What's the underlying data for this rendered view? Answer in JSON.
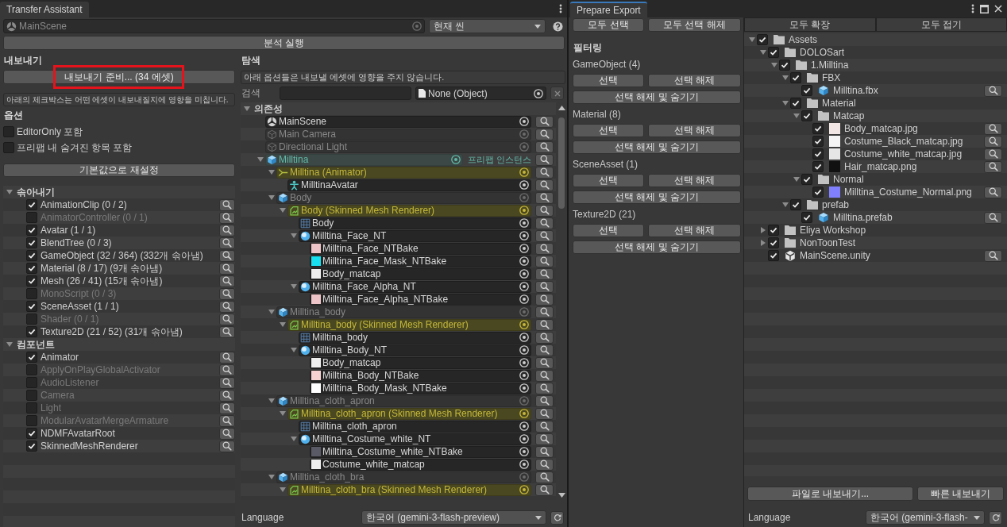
{
  "transfer_assistant": {
    "tab": {
      "title": "Transfer Assistant",
      "focused": false
    },
    "scene_field": {
      "value": "MainScene",
      "disabled": true
    },
    "scope_dropdown": {
      "value": "현재 씬"
    },
    "analyze_button": "분석 실행",
    "export": {
      "heading": "내보내기",
      "prepare_button": {
        "label": "내보내기 준비... (34 에셋)",
        "highlighted": true
      },
      "help": "아래의 체크박스는 어떤 에셋이 내보내질지에 영향을 미칩니다.",
      "options_heading": "옵션",
      "options": [
        {
          "label": "EditorOnly 포함",
          "checked": false
        },
        {
          "label": "프리팹 내 숨겨진 항목 포함",
          "checked": false
        }
      ],
      "reset_button": "기본값으로 재설정",
      "groups": [
        {
          "title": "솎아내기",
          "expanded": true,
          "items": [
            {
              "label": "AnimationClip (0 / 2)",
              "checked": true
            },
            {
              "label": "AnimatorController (0 / 1)",
              "checked": false
            },
            {
              "label": "Avatar (1 / 1)",
              "checked": true
            },
            {
              "label": "BlendTree (0 / 3)",
              "checked": true
            },
            {
              "label": "GameObject (32 / 364) (332개 솎아냄)",
              "checked": true
            },
            {
              "label": "Material (8 / 17) (9개 솎아냄)",
              "checked": true
            },
            {
              "label": "Mesh (26 / 41) (15개 솎아냄)",
              "checked": true
            },
            {
              "label": "MonoScript (0 / 3)",
              "checked": false
            },
            {
              "label": "SceneAsset (1 / 1)",
              "checked": true
            },
            {
              "label": "Shader (0 / 1)",
              "checked": false
            },
            {
              "label": "Texture2D (21 / 52) (31개 솎아냄)",
              "checked": true
            }
          ]
        },
        {
          "title": "컴포넌트",
          "expanded": true,
          "items": [
            {
              "label": "Animator",
              "checked": true
            },
            {
              "label": "ApplyOnPlayGlobalActivator",
              "checked": false
            },
            {
              "label": "AudioListener",
              "checked": false
            },
            {
              "label": "Camera",
              "checked": false
            },
            {
              "label": "Light",
              "checked": false
            },
            {
              "label": "ModularAvatarMergeArmature",
              "checked": false
            },
            {
              "label": "NDMFAvatarRoot",
              "checked": true
            },
            {
              "label": "SkinnedMeshRenderer",
              "checked": true
            }
          ]
        }
      ]
    },
    "explore": {
      "heading": "탐색",
      "help": "아래 옵션들은 내보낼 에셋에 영향을 주지 않습니다.",
      "search_label": "검색",
      "object_field": {
        "value": "None (Object)"
      },
      "dependencies": {
        "title": "의존성",
        "expanded": true,
        "nodes": [
          {
            "name": "MainScene",
            "kind": "scene"
          },
          {
            "name": "Main Camera",
            "kind": "object"
          },
          {
            "name": "Directional Light",
            "kind": "object"
          },
          {
            "name": "Milltina",
            "kind": "prefab",
            "badge": "프리팹 인스턴스",
            "expanded": true,
            "children": [
              {
                "name": "Milltina (Animator)",
                "kind": "animator",
                "expanded": true,
                "children": [
                  {
                    "name": "MilltinaAvatar",
                    "kind": "avatar"
                  }
                ]
              },
              {
                "name": "Body",
                "kind": "prefab_part",
                "expanded": true,
                "children": [
                  {
                    "name": "Body (Skinned Mesh Renderer)",
                    "kind": "renderer",
                    "expanded": true,
                    "children": [
                      {
                        "name": "Body",
                        "kind": "mesh"
                      },
                      {
                        "name": "Milltina_Face_NT",
                        "kind": "material",
                        "expanded": true,
                        "children": [
                          {
                            "name": "Milltina_Face_NTBake",
                            "kind": "texture",
                            "color": "#eec4c8"
                          },
                          {
                            "name": "Milltina_Face_Mask_NTBake",
                            "kind": "texture",
                            "color": "#18e0f0"
                          },
                          {
                            "name": "Body_matcap",
                            "kind": "texture",
                            "color": "#eeeeee"
                          }
                        ]
                      },
                      {
                        "name": "Milltina_Face_Alpha_NT",
                        "kind": "material",
                        "expanded": true,
                        "children": [
                          {
                            "name": "Milltina_Face_Alpha_NTBake",
                            "kind": "texture",
                            "color": "#eec4c8"
                          }
                        ]
                      }
                    ]
                  }
                ]
              },
              {
                "name": "Milltina_body",
                "kind": "prefab_part",
                "expanded": true,
                "children": [
                  {
                    "name": "Milltina_body (Skinned Mesh Renderer)",
                    "kind": "renderer",
                    "expanded": true,
                    "children": [
                      {
                        "name": "Milltina_body",
                        "kind": "mesh"
                      },
                      {
                        "name": "Milltina_Body_NT",
                        "kind": "material",
                        "expanded": true,
                        "children": [
                          {
                            "name": "Body_matcap",
                            "kind": "texture",
                            "color": "#eeeeee"
                          },
                          {
                            "name": "Milltina_Body_NTBake",
                            "kind": "texture",
                            "color": "#f6d2d2"
                          },
                          {
                            "name": "Milltina_Body_Mask_NTBake",
                            "kind": "texture",
                            "color": "#ffffff"
                          }
                        ]
                      }
                    ]
                  }
                ]
              },
              {
                "name": "Milltina_cloth_apron",
                "kind": "prefab_part",
                "expanded": true,
                "children": [
                  {
                    "name": "Milltina_cloth_apron (Skinned Mesh Renderer)",
                    "kind": "renderer",
                    "expanded": true,
                    "children": [
                      {
                        "name": "Milltina_cloth_apron",
                        "kind": "mesh"
                      },
                      {
                        "name": "Milltina_Costume_white_NT",
                        "kind": "material",
                        "expanded": true,
                        "children": [
                          {
                            "name": "Milltina_Costume_white_NTBake",
                            "kind": "texture",
                            "color": "#5a5a66"
                          },
                          {
                            "name": "Costume_white_matcap",
                            "kind": "texture",
                            "color": "#eeeeee"
                          }
                        ]
                      }
                    ]
                  }
                ]
              },
              {
                "name": "Milltina_cloth_bra",
                "kind": "prefab_part",
                "expanded": true,
                "children": [
                  {
                    "name": "Milltina_cloth_bra (Skinned Mesh Renderer)",
                    "kind": "renderer",
                    "expanded": true
                  }
                ]
              }
            ]
          }
        ]
      }
    },
    "language": {
      "label": "Language",
      "value": "한국어 (gemini-3-flash-preview)"
    }
  },
  "prepare_export": {
    "tab": {
      "title": "Prepare Export",
      "focused": true
    },
    "select_all_button": "모두 선택",
    "deselect_all_button": "모두 선택 해제",
    "filter_heading": "필터링",
    "filters": [
      {
        "title": "GameObject (4)",
        "select": "선택",
        "deselect": "선택 해제",
        "deselect_hide": "선택 해제 및 숨기기"
      },
      {
        "title": "Material (8)",
        "select": "선택",
        "deselect": "선택 해제",
        "deselect_hide": "선택 해제 및 숨기기"
      },
      {
        "title": "SceneAsset (1)",
        "select": "선택",
        "deselect": "선택 해제",
        "deselect_hide": "선택 해제 및 숨기기"
      },
      {
        "title": "Texture2D (21)",
        "select": "선택",
        "deselect": "선택 해제",
        "deselect_hide": "선택 해제 및 숨기기"
      }
    ],
    "expand_all_button": "모두 확장",
    "collapse_all_button": "모두 접기",
    "assets": [
      {
        "name": "Assets",
        "kind": "folder",
        "checked": true,
        "expanded": true,
        "children": [
          {
            "name": "DOLOSart",
            "kind": "folder",
            "checked": true,
            "expanded": true,
            "children": [
              {
                "name": "1.Milltina",
                "kind": "folder",
                "checked": true,
                "expanded": true,
                "children": [
                  {
                    "name": "FBX",
                    "kind": "folder",
                    "checked": true,
                    "expanded": true,
                    "children": [
                      {
                        "name": "Milltina.fbx",
                        "kind": "model",
                        "checked": true
                      }
                    ]
                  },
                  {
                    "name": "Material",
                    "kind": "folder",
                    "checked": true,
                    "expanded": true,
                    "children": [
                      {
                        "name": "Matcap",
                        "kind": "folder",
                        "checked": true,
                        "expanded": true,
                        "children": [
                          {
                            "name": "Body_matcap.jpg",
                            "kind": "texture",
                            "color": "#f2e6e4",
                            "checked": true
                          },
                          {
                            "name": "Costume_Black_matcap.jpg",
                            "kind": "texture",
                            "color": "#f4f4f4",
                            "checked": true
                          },
                          {
                            "name": "Costume_white_matcap.jpg",
                            "kind": "texture",
                            "color": "#e6e6e6",
                            "checked": true
                          },
                          {
                            "name": "Hair_matcap.png",
                            "kind": "texture",
                            "color": "#111111",
                            "checked": true
                          }
                        ]
                      },
                      {
                        "name": "Normal",
                        "kind": "folder",
                        "checked": true,
                        "expanded": true,
                        "children": [
                          {
                            "name": "Milltina_Costume_Normal.png",
                            "kind": "texture",
                            "color": "#8080ff",
                            "checked": true
                          }
                        ]
                      }
                    ]
                  },
                  {
                    "name": "prefab",
                    "kind": "folder",
                    "checked": true,
                    "expanded": true,
                    "children": [
                      {
                        "name": "Milltina.prefab",
                        "kind": "prefab",
                        "checked": true
                      }
                    ]
                  }
                ]
              }
            ]
          },
          {
            "name": "Eliya Workshop",
            "kind": "folder",
            "checked": true,
            "expanded": false
          },
          {
            "name": "NonToonTest",
            "kind": "folder",
            "checked": true,
            "expanded": false
          },
          {
            "name": "MainScene.unity",
            "kind": "scene",
            "checked": true
          }
        ]
      }
    ],
    "export_to_file_button": "파일로 내보내기...",
    "quick_export_button": "빠른 내보내기",
    "language": {
      "label": "Language",
      "value": "한국어 (gemini-3-flash-"
    }
  }
}
